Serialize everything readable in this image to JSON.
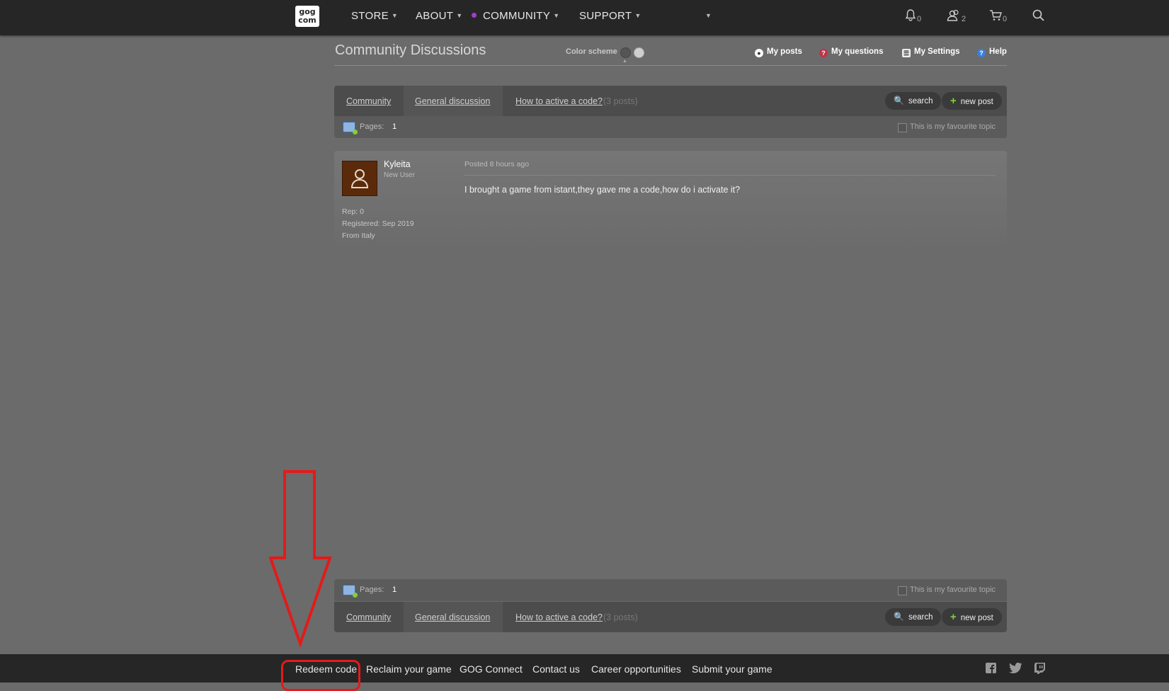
{
  "nav": {
    "logo_line1": "gog",
    "logo_line2": "com",
    "items": [
      "STORE",
      "ABOUT",
      "COMMUNITY",
      "SUPPORT"
    ],
    "notifications_count": "0",
    "friends_count": "2",
    "cart_count": "0"
  },
  "header": {
    "title": "Community Discussions",
    "color_scheme_label": "Color scheme",
    "links": [
      "My posts",
      "My questions",
      "My Settings",
      "Help"
    ]
  },
  "breadcrumb": {
    "community": "Community",
    "general": "General discussion",
    "topic": "How to active a code?",
    "posts_count": "(3 posts)",
    "search": "search",
    "new_post": "new post"
  },
  "pages": {
    "label": "Pages:",
    "current": "1",
    "favourite": "This is my favourite topic"
  },
  "post": {
    "author": "Kyleita",
    "role": "New User",
    "rep": "Rep: 0",
    "registered": "Registered: Sep 2019",
    "from": "From Italy",
    "posted": "Posted 8 hours ago",
    "body": "I brought a game from istant,they gave me a code,how do i activate it?"
  },
  "footer": {
    "links": [
      "Redeem code",
      "Reclaim your game",
      "GOG Connect",
      "Contact us",
      "Career opportunities",
      "Submit your game"
    ]
  },
  "colors": {
    "accent_purple": "#a43bcf",
    "annotation_red": "#e41a1a",
    "plus_green": "#7fd13b"
  }
}
